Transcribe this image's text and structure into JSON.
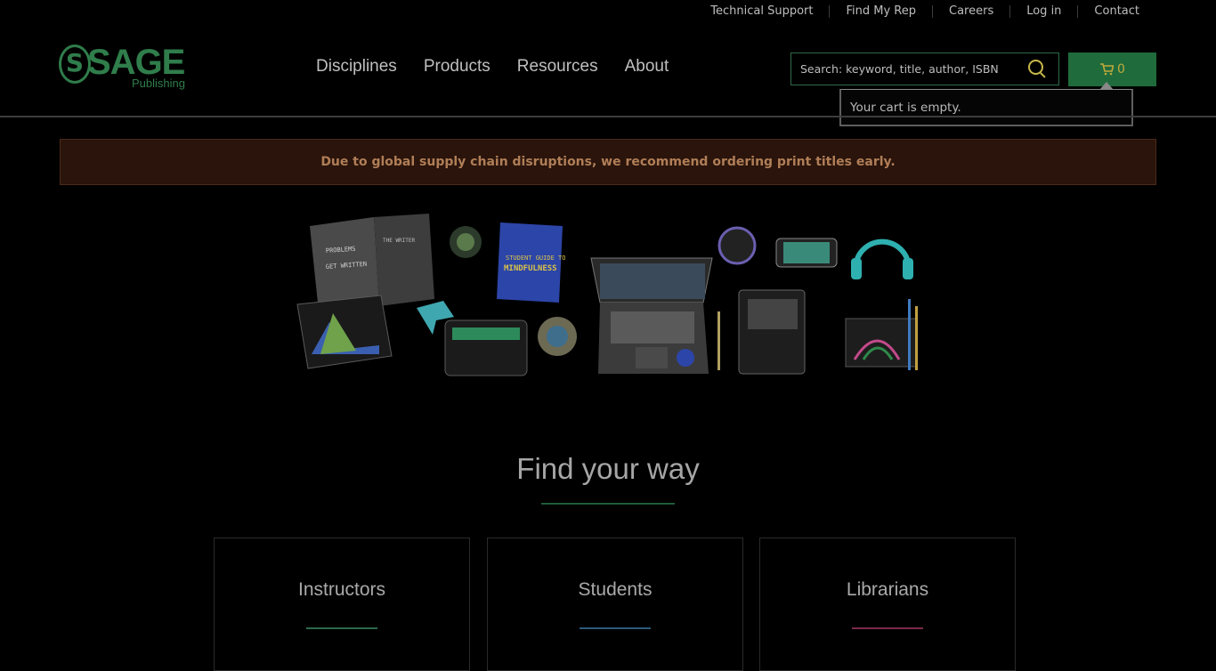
{
  "utility_nav": [
    "Technical Support",
    "Find My Rep",
    "Careers",
    "Log in",
    "Contact"
  ],
  "logo": {
    "name": "SAGE",
    "sub": "Publishing",
    "color": "#2f7d4b"
  },
  "main_nav": [
    "Disciplines",
    "Products",
    "Resources",
    "About"
  ],
  "search": {
    "placeholder": "Search: keyword, title, author, ISBN",
    "value": ""
  },
  "cart": {
    "count": "0",
    "empty_message": "Your cart is empty."
  },
  "alert": {
    "text": "Due to global supply chain disruptions, we recommend ordering print titles early."
  },
  "hero": {
    "book_left_lines": [
      "PROBLEMS",
      "GET WRITTEN"
    ],
    "book_left_right": "THE WRITER",
    "book_center": [
      "STUDENT GUIDE TO",
      "MINDFULNESS"
    ]
  },
  "find_way": {
    "title": "Find your way",
    "cards": [
      {
        "label": "Instructors",
        "accent": "#2b6a4a"
      },
      {
        "label": "Students",
        "accent": "#2b5a7a"
      },
      {
        "label": "Librarians",
        "accent": "#7a2a4a"
      }
    ]
  }
}
